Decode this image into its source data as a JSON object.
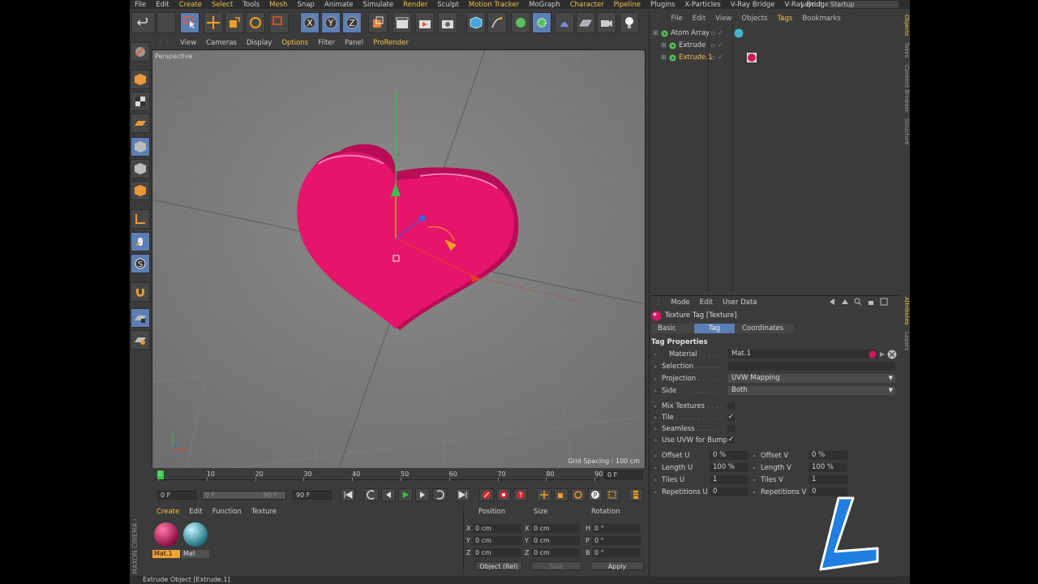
{
  "menubar": {
    "items": [
      "File",
      "Edit",
      "Create",
      "Select",
      "Tools",
      "Mesh",
      "Snap",
      "Animate",
      "Simulate",
      "Render",
      "Sculpt",
      "Motion Tracker",
      "MoGraph",
      "Character",
      "Pipeline",
      "Plugins",
      "X-Particles",
      "V-Ray Bridge",
      "V-Ray Bridge"
    ],
    "highlighted": [
      "Create",
      "Select",
      "Mesh",
      "Render",
      "Motion Tracker",
      "Character",
      "Pipeline"
    ],
    "layout_label": "Layout:",
    "layout_value": "Startup"
  },
  "viewport_menu": {
    "items": [
      "View",
      "Cameras",
      "Display",
      "Options",
      "Filter",
      "Panel",
      "ProRender"
    ],
    "highlighted": [
      "Options",
      "ProRender"
    ],
    "view_name": "Perspective",
    "grid_spacing": "Grid Spacing : 100 cm"
  },
  "timeline": {
    "ticks": [
      "0",
      "10",
      "20",
      "30",
      "40",
      "50",
      "60",
      "70",
      "80",
      "90"
    ],
    "current_frame_field": "0 F",
    "start_field": "0 F",
    "range_start": "0 F",
    "range_end": "90 F",
    "end_field": "90 F"
  },
  "material_manager": {
    "menu": [
      "Create",
      "Edit",
      "Function",
      "Texture"
    ],
    "highlighted": [
      "Create"
    ],
    "materials": [
      {
        "name": "Mat.1",
        "color": "#d0195e",
        "selected": true
      },
      {
        "name": "Mat",
        "color": "#3fb7c8",
        "selected": false
      }
    ]
  },
  "coordinates": {
    "headers": [
      "Position",
      "Size",
      "Rotation"
    ],
    "rows": [
      {
        "axis": "X",
        "position": "0 cm",
        "size_axis": "X",
        "size": "0 cm",
        "rot_axis": "H",
        "rotation": "0 °"
      },
      {
        "axis": "Y",
        "position": "0 cm",
        "size_axis": "Y",
        "size": "0 cm",
        "rot_axis": "P",
        "rotation": "0 °"
      },
      {
        "axis": "Z",
        "position": "0 cm",
        "size_axis": "Z",
        "size": "0 cm",
        "rot_axis": "B",
        "rotation": "0 °"
      }
    ],
    "mode": "Object (Rel)",
    "size_mode": "Size",
    "apply": "Apply"
  },
  "status_bar": "Extrude Object [Extrude.1]",
  "brand": "MAXON CINEMA 4D",
  "object_manager": {
    "menu": [
      "File",
      "Edit",
      "View",
      "Objects",
      "Tags",
      "Bookmarks"
    ],
    "highlighted": [
      "Tags"
    ],
    "objects": [
      {
        "name": "Atom Array",
        "selected": false
      },
      {
        "name": "Extrude",
        "selected": false
      },
      {
        "name": "Extrude.1",
        "selected": true
      }
    ]
  },
  "side_tabs": {
    "top": [
      "Objects",
      "Takes",
      "Content Browser",
      "Structure"
    ],
    "bottom": [
      "Attributes",
      "Layers"
    ]
  },
  "attributes": {
    "menu": [
      "Mode",
      "Edit",
      "User Data"
    ],
    "title": "Texture Tag [Texture]",
    "tabs": [
      "Basic",
      "Tag",
      "Coordinates"
    ],
    "active_tab": "Tag",
    "section": "Tag Properties",
    "material_label": "Material",
    "material_value": "Mat.1",
    "selection_label": "Selection",
    "projection_label": "Projection",
    "projection_value": "UVW Mapping",
    "side_label": "Side",
    "side_value": "Both",
    "mix_label": "Mix Textures",
    "tile_label": "Tile",
    "seamless_label": "Seamless",
    "uvw_bump_label": "Use UVW for Bump",
    "offset_u_label": "Offset U",
    "offset_u": "0 %",
    "offset_v_label": "Offset V",
    "offset_v": "0 %",
    "length_u_label": "Length U",
    "length_u": "100 %",
    "length_v_label": "Length V",
    "length_v": "100 %",
    "tiles_u_label": "Tiles U",
    "tiles_u": "1",
    "tiles_v_label": "Tiles V",
    "tiles_v": "1",
    "rep_u_label": "Repetitions U",
    "rep_u": "0",
    "rep_v_label": "Repetitions V",
    "rep_v": "0"
  },
  "colors": {
    "accent": "#5c7fb5",
    "highlight_text": "#f1c64a",
    "heart": "#e5156a",
    "watermark": "#1e7fe0"
  }
}
